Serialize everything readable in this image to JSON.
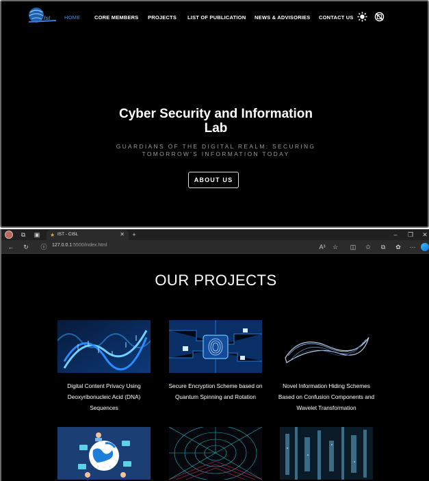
{
  "nav": {
    "logo_text": "Ist",
    "items": [
      "HOME",
      "CORE MEMBERS",
      "PROJECTS",
      "LIST OF PUBLICATION",
      "NEWS & ADVISORIES",
      "CONTACT US"
    ],
    "active_item": "HOME"
  },
  "hero": {
    "title_line1": "Cyber Security and Information",
    "title_line2": "Lab",
    "subtitle_line1": "GUARDIANS OF THE DIGITAL REALM: SECURING",
    "subtitle_line2": "TOMORROW'S INFORMATION TODAY",
    "button": "ABOUT US"
  },
  "browser": {
    "tab_title": "IST - CISL",
    "url_host": "127.0.0.1",
    "url_rest": ":5500/index.html",
    "read_aloud_label": "A³",
    "more_label": "···"
  },
  "projects": {
    "heading": "OUR PROJECTS",
    "cards": [
      {
        "title_lines": [
          "Digital Content Privacy Using",
          "Deoxyribonucleic Acid (DNA)",
          "Sequences"
        ],
        "image": "dna-helix"
      },
      {
        "title_lines": [
          "Secure Encryption Scheme based on",
          "Quantum Spinning and Rotation"
        ],
        "image": "circuit-fingerprint-lock"
      },
      {
        "title_lines": [
          "Novel Information Hiding Schemes",
          "Based on Confusion Components and",
          "Wavelet Transformation"
        ],
        "image": "mobius-ribbon"
      },
      {
        "title_lines": [],
        "image": "globe-network-people"
      },
      {
        "title_lines": [],
        "image": "wireframe-tunnel"
      },
      {
        "title_lines": [],
        "image": "data-streams"
      }
    ]
  },
  "colors": {
    "active_nav": "#4f8fd6",
    "background": "#000000",
    "browser_chrome": "#2b2b2b"
  }
}
